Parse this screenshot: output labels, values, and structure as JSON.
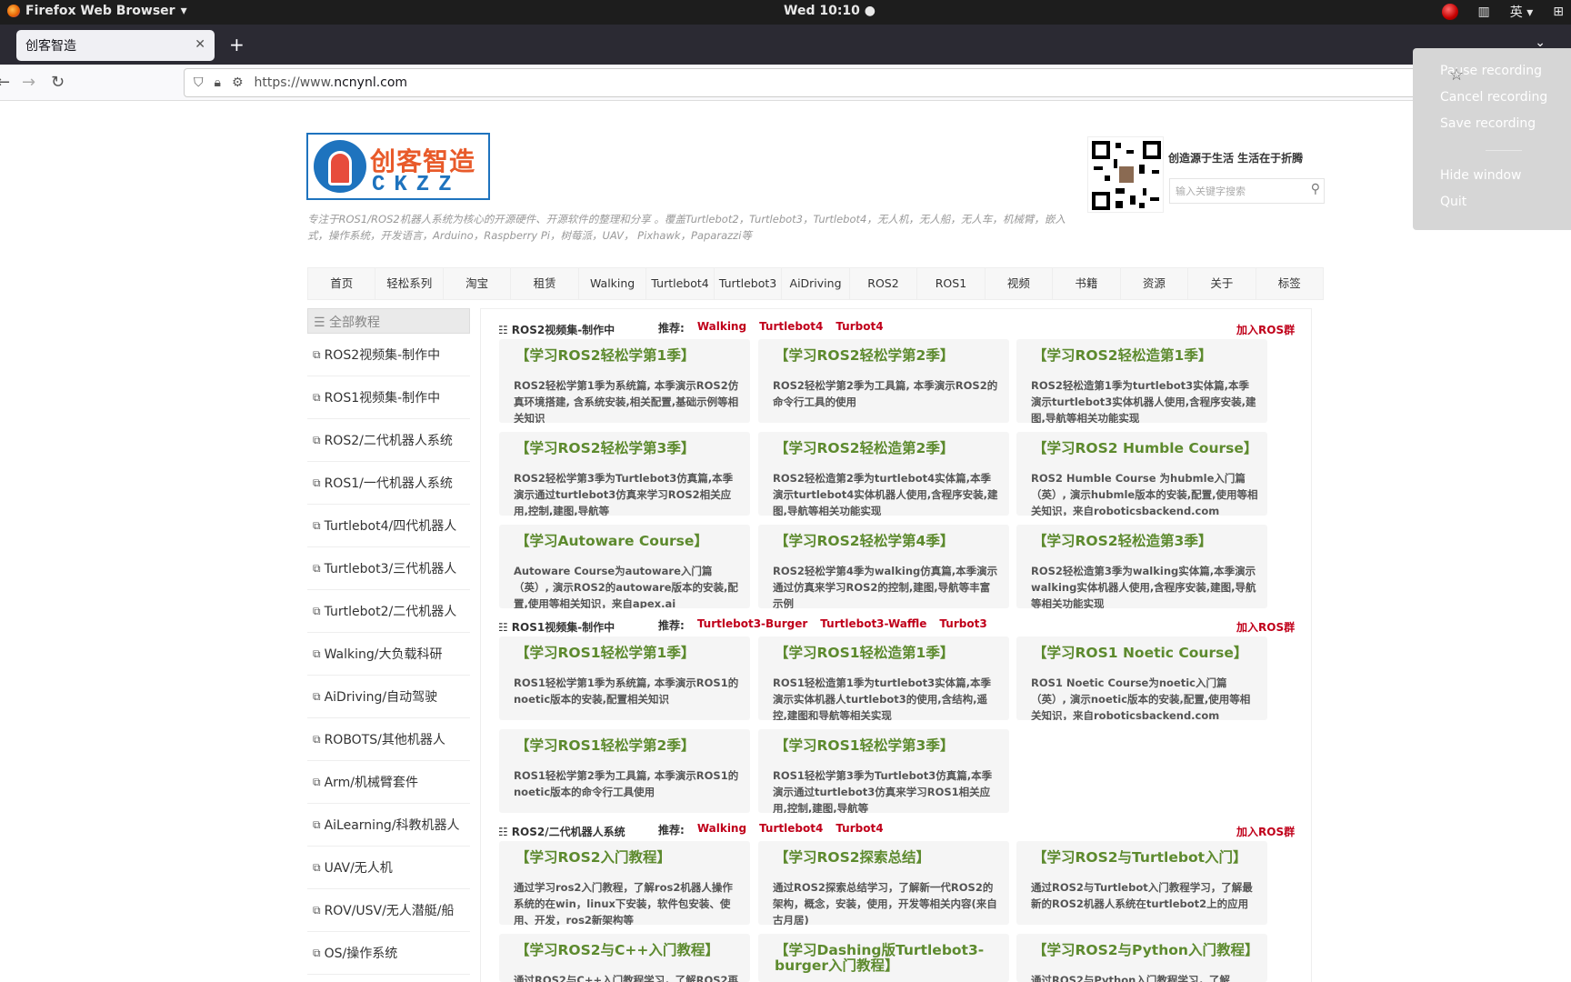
{
  "system": {
    "app_name": "Firefox Web Browser",
    "clock": "Wed 10:10 ●",
    "ime": "英"
  },
  "browser": {
    "tab_title": "创客智造",
    "url_prefix": "https://www.",
    "url_domain": "ncnynl.com"
  },
  "recorder_menu": {
    "items": [
      "Pause recording",
      "Cancel recording",
      "Save recording",
      "Hide window",
      "Quit"
    ]
  },
  "site": {
    "logo_cn": "创客智造",
    "logo_en": "CKZZ",
    "description": "专注于ROS1/ROS2机器人系统为核心的开源硬件、开源软件的整理和分享 。覆盖Turtlebot2，Turtlebot3，Turtlebot4，无人机，无人船，无人车，机械臂，嵌入式，操作系统，开发语言，Arduino，Raspberry Pi，树莓派，UAV， Pixhawk，Paparazzi等",
    "slogan": "创造源于生活 生活在于折腾",
    "search_placeholder": "输入关键字搜索",
    "nav": [
      "首页",
      "轻松系列",
      "淘宝",
      "租赁",
      "Walking",
      "Turtlebot4",
      "Turtlebot3",
      "AiDriving",
      "ROS2",
      "ROS1",
      "视频",
      "书籍",
      "资源",
      "关于",
      "标签"
    ]
  },
  "sidebar": {
    "header": "全部教程",
    "items": [
      "ROS2视频集-制作中",
      "ROS1视频集-制作中",
      "ROS2/二代机器人系统",
      "ROS1/一代机器人系统",
      "Turtlebot4/四代机器人",
      "Turtlebot3/三代机器人",
      "Turtlebot2/二代机器人",
      "Walking/大负载科研",
      "AiDriving/自动驾驶",
      "ROBOTS/其他机器人",
      "Arm/机械臂套件",
      "AiLearning/科教机器人",
      "UAV/无人机",
      "ROV/USV/无人潜艇/船",
      "OS/操作系统"
    ]
  },
  "sections": [
    {
      "title": "ROS2视频集-制作中",
      "rec_label": "推荐:",
      "recs": [
        "Walking",
        "Turtlebot4",
        "Turbot4"
      ],
      "join": "加入ROS群",
      "cards": [
        {
          "title": "【学习ROS2轻松学第1季】",
          "desc": "ROS2轻松学第1季为系统篇, 本季演示ROS2仿真环境搭建, 含系统安装,相关配置,基础示例等相关知识"
        },
        {
          "title": "【学习ROS2轻松学第2季】",
          "desc": "ROS2轻松学第2季为工具篇, 本季演示ROS2的命令行工具的使用"
        },
        {
          "title": "【学习ROS2轻松造第1季】",
          "desc": "ROS2轻松造第1季为turtlebot3实体篇,本季演示turtlebot3实体机器人使用,含程序安装,建图,导航等相关功能实现"
        },
        {
          "title": "【学习ROS2轻松学第3季】",
          "desc": "ROS2轻松学第3季为Turtlebot3仿真篇,本季演示通过turtlebot3仿真来学习ROS2相关应用,控制,建图,导航等"
        },
        {
          "title": "【学习ROS2轻松造第2季】",
          "desc": "ROS2轻松造第2季为turtlebot4实体篇,本季演示turtlebot4实体机器人使用,含程序安装,建图,导航等相关功能实现"
        },
        {
          "title": "【学习ROS2 Humble Course】",
          "desc": "ROS2 Humble Course 为hubmle入门篇（英）, 演示hubmle版本的安装,配置,使用等相关知识，来自roboticsbackend.com"
        },
        {
          "title": "【学习Autoware Course】",
          "desc": "Autoware Course为autoware入门篇（英）, 演示ROS2的autoware版本的安装,配置,使用等相关知识，来自apex.ai"
        },
        {
          "title": "【学习ROS2轻松学第4季】",
          "desc": "ROS2轻松学第4季为walking仿真篇,本季演示通过仿真来学习ROS2的控制,建图,导航等丰富示例"
        },
        {
          "title": "【学习ROS2轻松造第3季】",
          "desc": "ROS2轻松造第3季为walking实体篇,本季演示walking实体机器人使用,含程序安装,建图,导航等相关功能实现"
        }
      ]
    },
    {
      "title": "ROS1视频集-制作中",
      "rec_label": "推荐:",
      "recs": [
        "Turtlebot3-Burger",
        "Turtlebot3-Waffle",
        "Turbot3"
      ],
      "join": "加入ROS群",
      "cards": [
        {
          "title": "【学习ROS1轻松学第1季】",
          "desc": "ROS1轻松学第1季为系统篇, 本季演示ROS1的noetic版本的安装,配置相关知识"
        },
        {
          "title": "【学习ROS1轻松造第1季】",
          "desc": "ROS1轻松造第1季为turtlebot3实体篇,本季演示实体机器人turtlebot3的使用,含结构,遥控,建图和导航等相关实现"
        },
        {
          "title": "【学习ROS1 Noetic Course】",
          "desc": "ROS1 Noetic Course为noetic入门篇（英）, 演示noetic版本的安装,配置,使用等相关知识，来自roboticsbackend.com"
        },
        {
          "title": "【学习ROS1轻松学第2季】",
          "desc": "ROS1轻松学第2季为工具篇, 本季演示ROS1的noetic版本的命令行工具使用"
        },
        {
          "title": "【学习ROS1轻松学第3季】",
          "desc": "ROS1轻松学第3季为Turtlebot3仿真篇,本季演示通过turtlebot3仿真来学习ROS1相关应用,控制,建图,导航等"
        }
      ]
    },
    {
      "title": "ROS2/二代机器人系统",
      "rec_label": "推荐:",
      "recs": [
        "Walking",
        "Turtlebot4",
        "Turbot4"
      ],
      "join": "加入ROS群",
      "cards": [
        {
          "title": "【学习ROS2入门教程】",
          "desc": "通过学习ros2入门教程，了解ros2机器人操作系统的在win，linux下安装，软件包安装、使用、开发，ros2新架构等"
        },
        {
          "title": "【学习ROS2探索总结】",
          "desc": "通过ROS2探索总结学习，了解新一代ROS2的架构，概念，安装，使用，开发等相关内容(来自古月居)"
        },
        {
          "title": "【学习ROS2与Turtlebot入门】",
          "desc": "通过ROS2与Turtlebot入门教程学习，了解最新的ROS2机器人系统在turtlebot2上的应用"
        },
        {
          "title": "【学习ROS2与C++入门教程】",
          "desc": "通过ROS2与C++入门教程学习，了解ROS2再"
        },
        {
          "title": "【学习Dashing版Turtlebot3-burger入门教程】",
          "desc": ""
        },
        {
          "title": "【学习ROS2与Python入门教程】",
          "desc": "通过ROS2与Python入门教程学习，了解"
        }
      ]
    }
  ]
}
